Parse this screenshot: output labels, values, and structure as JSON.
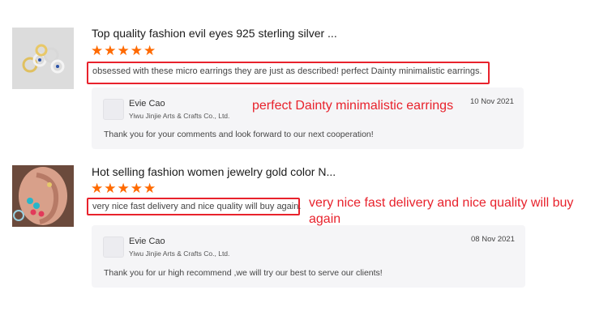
{
  "reviews": [
    {
      "title": "Top quality fashion evil eyes 925 sterling silver ...",
      "stars": "★★★★★",
      "comment": "obsessed with these micro earrings they are just as described! perfect Dainty minimalistic earrings.",
      "reply": {
        "seller": "Evie Cao",
        "company": "Yiwu Jinjie Arts & Crafts Co., Ltd.",
        "date": "10 Nov 2021",
        "text": "Thank you for your comments and look forward to our next cooperation!"
      },
      "annotation": "perfect Dainty minimalistic earrings"
    },
    {
      "title": "Hot selling fashion women jewelry gold color N...",
      "stars": "★★★★★",
      "comment": "very nice fast delivery and nice quality will buy again.",
      "reply": {
        "seller": "Evie Cao",
        "company": "Yiwu Jinjie Arts & Crafts Co., Ltd.",
        "date": "08 Nov 2021",
        "text": "Thank you for ur high recommend ,we will try our best to serve our clients!"
      },
      "annotation_line1": "very nice fast delivery and nice quality will buy",
      "annotation_line2": "again"
    }
  ]
}
